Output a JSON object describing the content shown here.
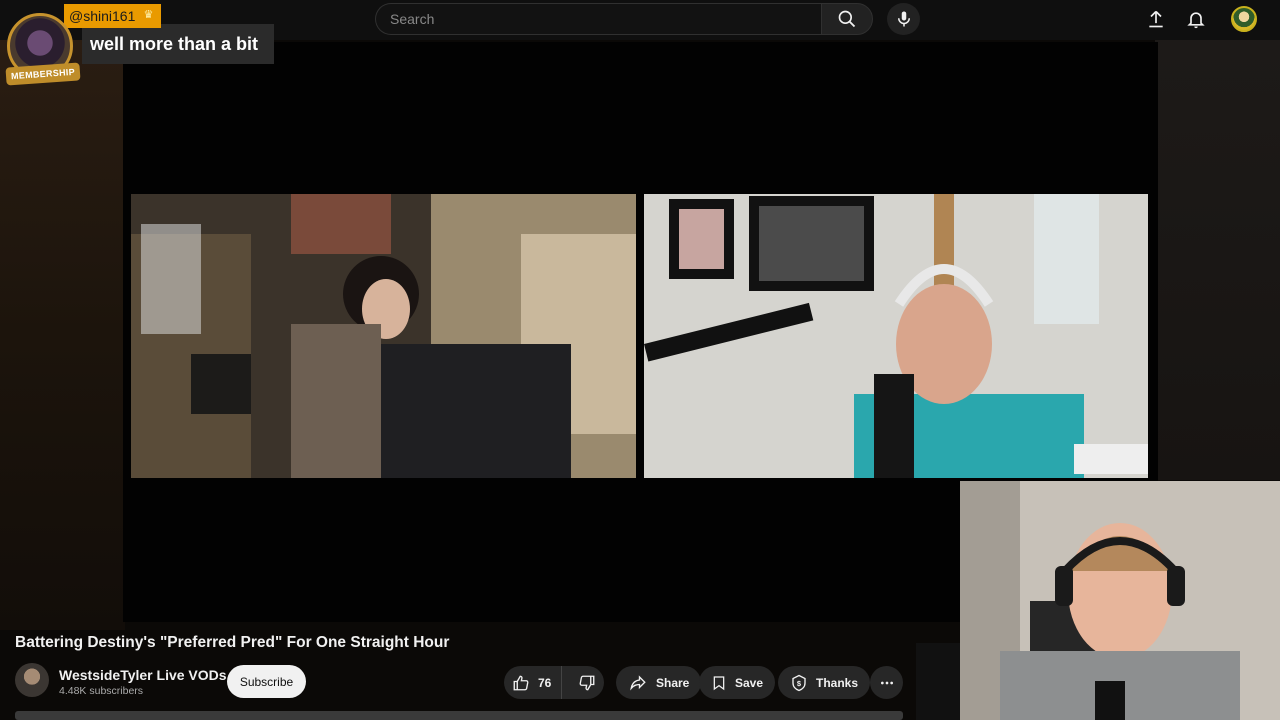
{
  "header": {
    "search_placeholder": "Search"
  },
  "chat": {
    "username": "@shini161",
    "badge": "MEMBERSHIP",
    "message": "well more than a bit"
  },
  "video": {
    "title": "Battering Destiny's \"Preferred Pred\" For One Straight Hour"
  },
  "channel": {
    "name": "WestsideTyler Live VODs",
    "subscribers": "4.48K subscribers",
    "subscribe_label": "Subscribe"
  },
  "actions": {
    "like_count": "76",
    "share_label": "Share",
    "save_label": "Save",
    "thanks_label": "Thanks"
  },
  "icons": [
    "search-icon",
    "mic-icon",
    "upload-icon",
    "bell-icon",
    "thumbs-up-icon",
    "thumbs-down-icon",
    "share-icon",
    "bookmark-icon",
    "thanks-icon",
    "more-icon"
  ],
  "colors": {
    "accent_chat": "#e99a00",
    "membership": "#bf8d2a",
    "button_bg": "#272727",
    "subscribe_bg": "#f1f1f1"
  }
}
